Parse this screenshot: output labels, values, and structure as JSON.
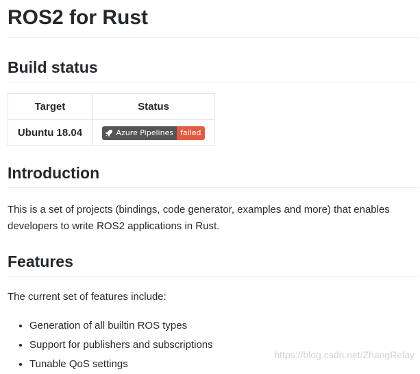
{
  "title": "ROS2 for Rust",
  "build_status": {
    "heading": "Build status",
    "table": {
      "headers": [
        "Target",
        "Status"
      ],
      "rows": [
        {
          "target": "Ubuntu 18.04",
          "badge": {
            "label": "Azure Pipelines",
            "status": "failed",
            "status_color": "#e05d44",
            "label_color": "#555555",
            "icon": "azure-pipelines-icon"
          }
        }
      ]
    }
  },
  "introduction": {
    "heading": "Introduction",
    "text": "This is a set of projects (bindings, code generator, examples and more) that enables developers to write ROS2 applications in Rust."
  },
  "features": {
    "heading": "Features",
    "intro": "The current set of features include:",
    "items": [
      "Generation of all builtin ROS types",
      "Support for publishers and subscriptions",
      "Tunable QoS settings"
    ]
  },
  "watermark": "https://blog.csdn.net/ZhangRelay"
}
